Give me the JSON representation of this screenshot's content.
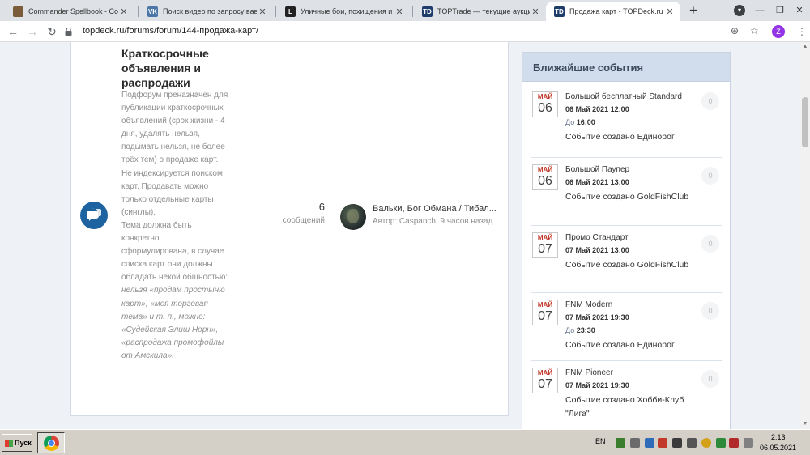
{
  "browser": {
    "tabs": [
      {
        "title": "Commander Spellbook - Combo D",
        "favicon": "spellbook-icon",
        "color": "#7a5c3a",
        "glyph": "",
        "active": false
      },
      {
        "title": "Поиск видео по запросу вавилов",
        "favicon": "vk-icon",
        "color": "#4a76a8",
        "glyph": "VK",
        "active": false
      },
      {
        "title": "Уличные бои, похищения и расс",
        "favicon": "l-icon",
        "color": "#222222",
        "glyph": "L",
        "active": false
      },
      {
        "title": "TOPTrade — текущие аукционы",
        "favicon": "td-icon",
        "color": "#1e3d6b",
        "glyph": "TD",
        "active": false
      },
      {
        "title": "Продажа карт - TOPDeck.ru",
        "favicon": "td-icon",
        "color": "#1e3d6b",
        "glyph": "TD",
        "active": true
      }
    ],
    "url": "topdeck.ru/forums/forum/144-продажа-карт/",
    "profile_initial": "Z"
  },
  "forum": {
    "title": "Краткосрочные объявления и распродажи",
    "description_plain": "Подфорум преназначен для публикации краткосрочных объявлений (срок жизни - 4 дня, удалять нельзя, подымать нельзя, не более трёх тем) о продаже карт. Не индексируется поиском карт. Продавать можно только отдельные карты (синглы).",
    "description_plain2": "Тема должна быть конкретно сформулирована, в случае списка карт они должны обладать некой общностью: ",
    "description_italic": "нельзя «продам простыню карт», «моя торговая тема» и т. п., можно: «Судейская Элиш Норн», «распродажа промофойлы от Амскила».",
    "stats_count": "6",
    "stats_label": "сообщений",
    "last_post_title": "Вальки, Бог Обмана / Тибал...",
    "last_post_meta": "Автор: Caspanch, 9 часов назад"
  },
  "events": {
    "header": "Ближайшие события",
    "items": [
      {
        "month": "МАЙ",
        "day": "06",
        "title": "Большой бесплатный Standard",
        "datetime": "06 Май 2021 12:00",
        "until_label": "До",
        "until_time": "16:00",
        "by_label": "Событие создано",
        "by": "Единорог",
        "count": "0"
      },
      {
        "month": "МАЙ",
        "day": "06",
        "title": "Большой Паупер",
        "datetime": "06 Май 2021 13:00",
        "until_label": "",
        "until_time": "",
        "by_label": "Событие создано",
        "by": "GoldFishClub",
        "count": "0"
      },
      {
        "month": "МАЙ",
        "day": "07",
        "title": "Промо Стандарт",
        "datetime": "07 Май 2021 13:00",
        "until_label": "",
        "until_time": "",
        "by_label": "Событие создано",
        "by": "GoldFishClub",
        "count": "0"
      },
      {
        "month": "МАЙ",
        "day": "07",
        "title": "FNM Modern",
        "datetime": "07 Май 2021 19:30",
        "until_label": "До",
        "until_time": "23:30",
        "by_label": "Событие создано",
        "by": "Единорог",
        "count": "0"
      },
      {
        "month": "МАЙ",
        "day": "07",
        "title": "FNM Pioneer",
        "datetime": "07 Май 2021 19:30",
        "until_label": "",
        "until_time": "",
        "by_label": "Событие создано",
        "by": "Хобби-Клуб \"Лига\"",
        "count": "0"
      }
    ]
  },
  "taskbar": {
    "start_label": "Пуск",
    "lang": "EN",
    "time": "2:13",
    "date": "06.05.2021"
  }
}
